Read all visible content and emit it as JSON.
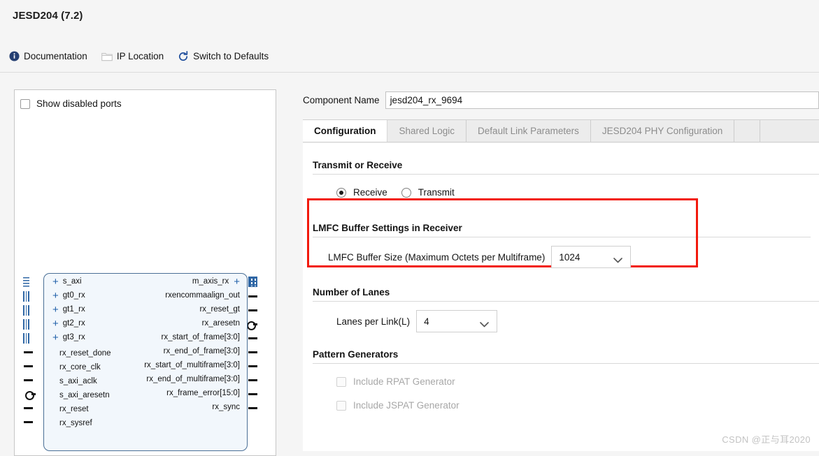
{
  "header": {
    "title": "JESD204 (7.2)"
  },
  "toolbar": {
    "items": [
      {
        "label": "Documentation",
        "icon": "info-icon"
      },
      {
        "label": "IP Location",
        "icon": "folder-icon"
      },
      {
        "label": "Switch to Defaults",
        "icon": "refresh-icon"
      }
    ]
  },
  "diagram": {
    "show_disabled_ports_label": "Show disabled ports",
    "show_disabled_ports_checked": false,
    "left_ports": [
      {
        "name": "s_axi",
        "type": "bus-dotted",
        "expandable": true
      },
      {
        "name": "gt0_rx",
        "type": "bus",
        "expandable": true
      },
      {
        "name": "gt1_rx",
        "type": "bus",
        "expandable": true
      },
      {
        "name": "gt2_rx",
        "type": "bus",
        "expandable": true
      },
      {
        "name": "gt3_rx",
        "type": "bus",
        "expandable": true
      },
      {
        "name": "rx_reset_done",
        "type": "wire",
        "expandable": false
      },
      {
        "name": "rx_core_clk",
        "type": "wire",
        "expandable": false
      },
      {
        "name": "s_axi_aclk",
        "type": "wire",
        "expandable": false
      },
      {
        "name": "s_axi_aresetn",
        "type": "active-low",
        "expandable": false
      },
      {
        "name": "rx_reset",
        "type": "wire",
        "expandable": false
      },
      {
        "name": "rx_sysref",
        "type": "wire",
        "expandable": false
      }
    ],
    "right_ports": [
      {
        "name": "m_axis_rx",
        "type": "bus-grid",
        "expandable": true
      },
      {
        "name": "rxencommaalign_out",
        "type": "wire",
        "expandable": false
      },
      {
        "name": "rx_reset_gt",
        "type": "wire",
        "expandable": false
      },
      {
        "name": "rx_aresetn",
        "type": "active-low",
        "expandable": false
      },
      {
        "name": "rx_start_of_frame[3:0]",
        "type": "wire",
        "expandable": false
      },
      {
        "name": "rx_end_of_frame[3:0]",
        "type": "wire",
        "expandable": false
      },
      {
        "name": "rx_start_of_multiframe[3:0]",
        "type": "wire",
        "expandable": false
      },
      {
        "name": "rx_end_of_multiframe[3:0]",
        "type": "wire",
        "expandable": false
      },
      {
        "name": "rx_frame_error[15:0]",
        "type": "wire",
        "expandable": false
      },
      {
        "name": "rx_sync",
        "type": "wire",
        "expandable": false
      }
    ]
  },
  "config": {
    "component_name_label": "Component Name",
    "component_name_value": "jesd204_rx_9694",
    "tabs": [
      {
        "label": "Configuration",
        "active": true
      },
      {
        "label": "Shared Logic",
        "active": false
      },
      {
        "label": "Default Link Parameters",
        "active": false
      },
      {
        "label": "JESD204 PHY Configuration",
        "active": false
      }
    ],
    "transmit_or_receive": {
      "section_title": "Transmit or Receive",
      "options": [
        {
          "label": "Receive",
          "selected": true
        },
        {
          "label": "Transmit",
          "selected": false
        }
      ]
    },
    "lmfc": {
      "section_title": "LMFC Buffer Settings in Receiver",
      "field_label": "LMFC Buffer Size (Maximum Octets per Multiframe)",
      "value": "1024",
      "highlight_color": "#f21a0d"
    },
    "lanes": {
      "section_title": "Number of Lanes",
      "field_label": "Lanes per Link(L)",
      "value": "4"
    },
    "pattern_generators": {
      "section_title": "Pattern Generators",
      "items": [
        {
          "label": "Include RPAT Generator",
          "checked": false,
          "disabled": true
        },
        {
          "label": "Include JSPAT Generator",
          "checked": false,
          "disabled": true
        }
      ]
    }
  },
  "watermark": "CSDN @正与耳2020"
}
